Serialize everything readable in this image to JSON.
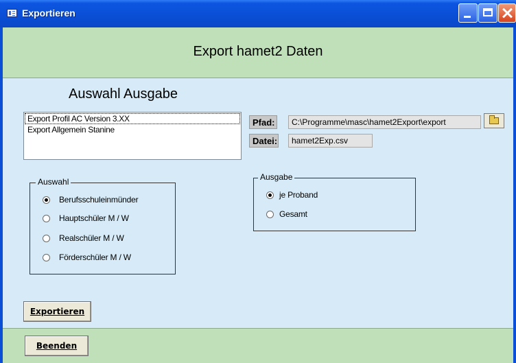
{
  "window": {
    "title": "Exportieren",
    "controls": {
      "minimize_icon": "minimize-icon",
      "maximize_icon": "maximize-icon",
      "close_icon": "close-icon"
    }
  },
  "header": {
    "title": "Export hamet2 Daten"
  },
  "selection": {
    "title": "Auswahl Ausgabe",
    "list_items": [
      "Export Profil AC Version 3.XX",
      "Export Allgemein Stanine"
    ],
    "selected_index": 0
  },
  "path": {
    "label": "Pfad:",
    "value": "C:\\Programme\\masc\\hamet2Export\\export",
    "browse_icon": "folder-open-icon"
  },
  "file": {
    "label": "Datei:",
    "value": "hamet2Exp.csv"
  },
  "auswahl": {
    "legend": "Auswahl",
    "options": [
      "Berufsschuleinmünder",
      "Hauptschüler M / W",
      "Realschüler M / W",
      "Förderschüler M / W"
    ],
    "selected": "Berufsschuleinmünder"
  },
  "ausgabe": {
    "legend": "Ausgabe",
    "options": [
      "je Proband",
      "Gesamt"
    ],
    "selected": "je Proband"
  },
  "buttons": {
    "export": "Exportieren",
    "quit": "Beenden"
  },
  "colors": {
    "titlebar": "#0b4fd6",
    "band": "#bfe0b8",
    "client": "#d6ebf7"
  }
}
